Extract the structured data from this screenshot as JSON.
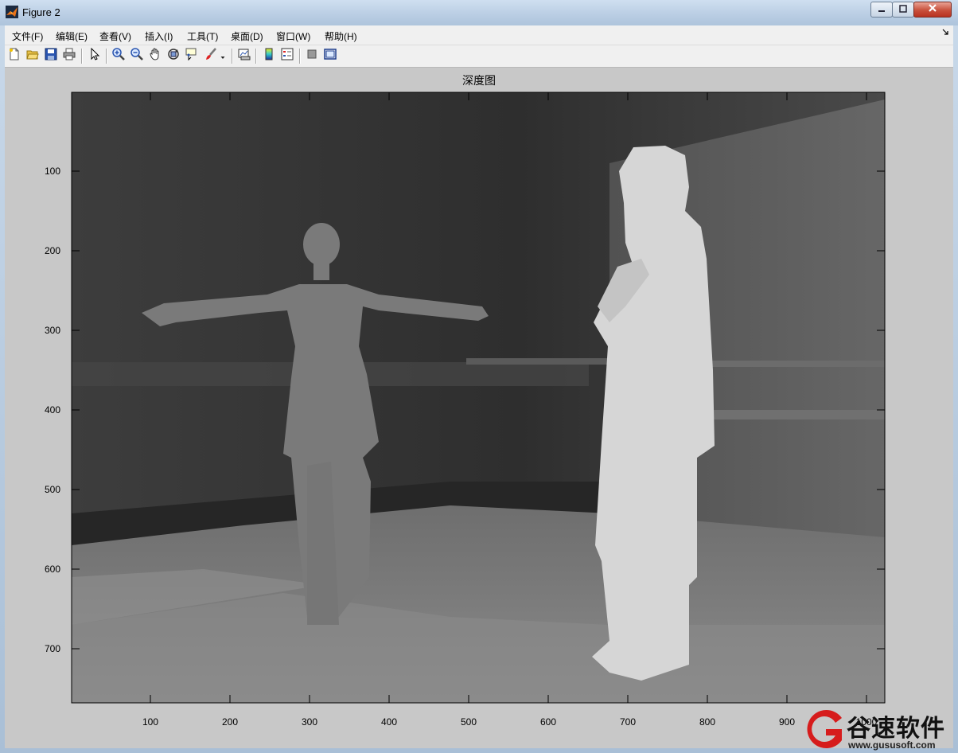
{
  "window": {
    "title": "Figure 2",
    "min_icon": "minimize-icon",
    "max_icon": "maximize-icon",
    "close_icon": "close-icon"
  },
  "menu": {
    "items": [
      {
        "label": "文件(F)"
      },
      {
        "label": "编辑(E)"
      },
      {
        "label": "查看(V)"
      },
      {
        "label": "插入(I)"
      },
      {
        "label": "工具(T)"
      },
      {
        "label": "桌面(D)"
      },
      {
        "label": "窗口(W)"
      },
      {
        "label": "帮助(H)"
      }
    ]
  },
  "toolbar": {
    "buttons": [
      "new-figure-icon",
      "open-file-icon",
      "save-icon",
      "print-icon",
      "pointer-icon",
      "zoom-in-icon",
      "zoom-out-icon",
      "pan-hand-icon",
      "rotate-3d-icon",
      "data-cursor-icon",
      "brush-icon",
      "dropdown-arrow-icon",
      "link-plot-icon",
      "colorbar-icon",
      "legend-icon",
      "hide-plot-tools-icon",
      "show-plot-tools-icon"
    ]
  },
  "figure": {
    "title": "深度图",
    "x_ticks": [
      "100",
      "200",
      "300",
      "400",
      "500",
      "600",
      "700",
      "800",
      "900",
      "1000"
    ],
    "y_ticks": [
      "100",
      "200",
      "300",
      "400",
      "500",
      "600",
      "700"
    ],
    "image_description_name": "depth-map-image"
  },
  "watermark": {
    "text": "谷速软件",
    "url": "www.gususoft.com"
  },
  "colors": {
    "figure_bg": "#c8c8c8",
    "menubar_bg": "#f0f0f0",
    "titlebar": "#b9cde3"
  }
}
